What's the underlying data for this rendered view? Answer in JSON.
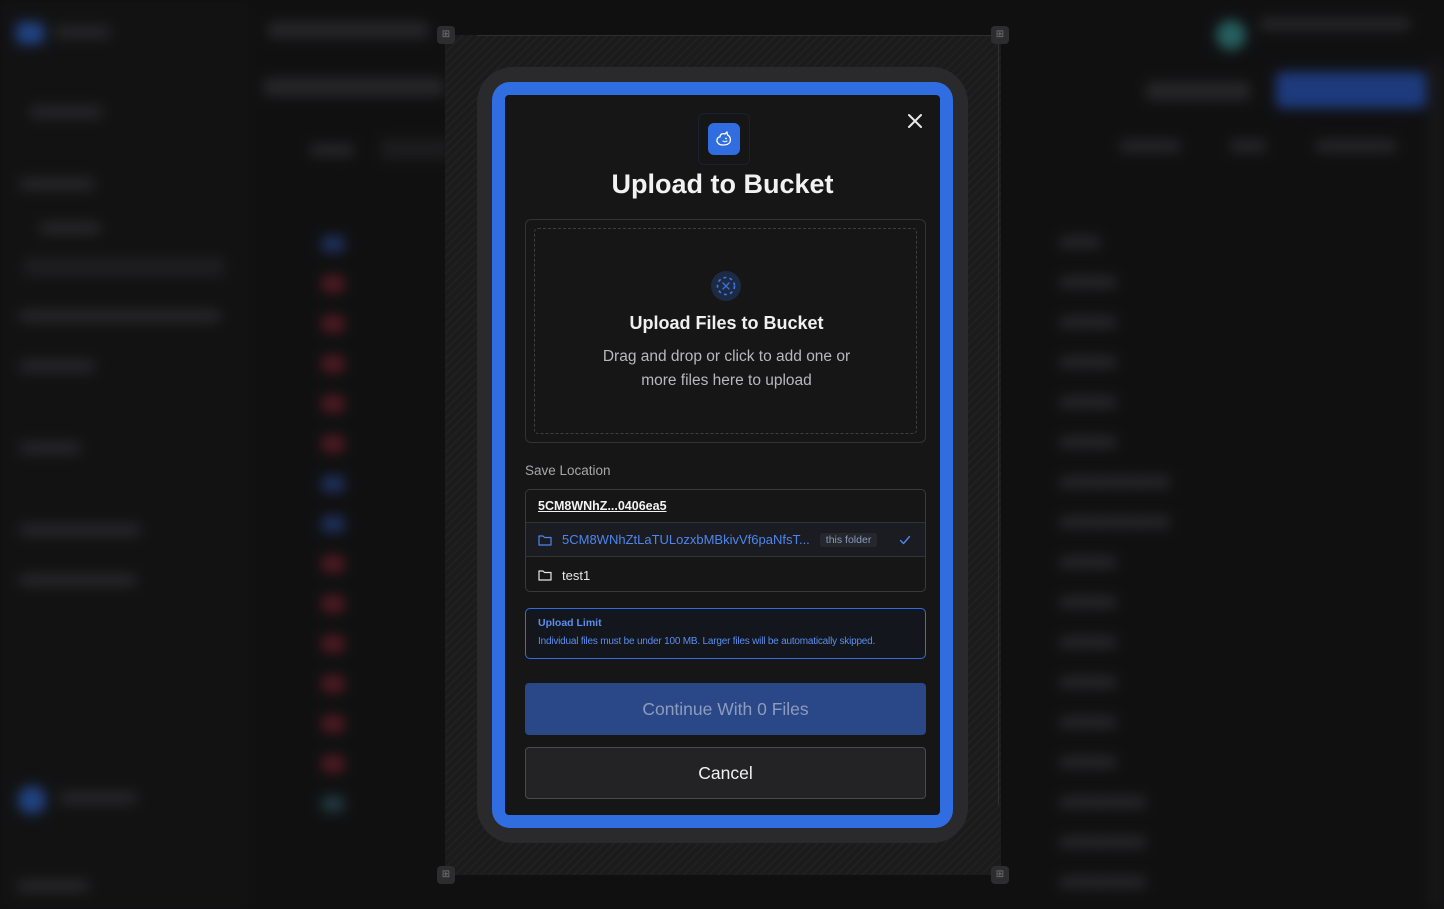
{
  "modal": {
    "title": "Upload to Bucket",
    "dropzone": {
      "title": "Upload Files to Bucket",
      "subtitle": "Drag and drop or click to add one or more files here to upload"
    },
    "save_location": {
      "label": "Save Location",
      "bucket": "5CM8WNhZ...0406ea5",
      "folders": [
        {
          "name": "5CM8WNhZtLaTULozxbMBkivVf6paNfsT...",
          "badge": "this folder",
          "selected": true
        },
        {
          "name": "test1",
          "selected": false
        }
      ]
    },
    "upload_limit": {
      "title": "Upload Limit",
      "text": "Individual files must be under 100 MB. Larger files will be automatically skipped."
    },
    "continue_label": "Continue With 0 Files",
    "cancel_label": "Cancel"
  },
  "colors": {
    "accent": "#2f6de0",
    "modal_bg": "#161617",
    "continue_bg": "#2a4887",
    "selected_text": "#4f86ee"
  },
  "icons": [
    "close-icon",
    "bucket-logo-icon",
    "upload-drop-icon",
    "folder-icon",
    "check-icon"
  ]
}
